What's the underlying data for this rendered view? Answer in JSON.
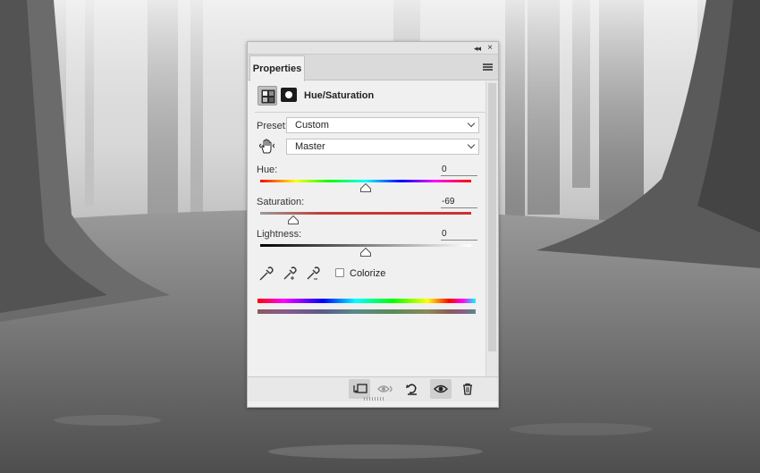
{
  "panel": {
    "tab_label": "Properties",
    "adjustment_title": "Hue/Saturation",
    "preset_label": "Preset:",
    "preset_value": "Custom",
    "channel_value": "Master",
    "hue": {
      "label": "Hue:",
      "value": "0",
      "fraction": 0.5
    },
    "saturation": {
      "label": "Saturation:",
      "value": "-69",
      "fraction": 0.155
    },
    "lightness": {
      "label": "Lightness:",
      "value": "0",
      "fraction": 0.5
    },
    "colorize_label": "Colorize",
    "colorize_checked": false
  },
  "icons": {
    "collapse": "double-chevron-left-icon",
    "close": "close-icon",
    "menu": "panel-menu-icon",
    "adjustment": "hue-saturation-icon",
    "mask": "layer-mask-icon",
    "targeted_adjustment": "hand-icon",
    "eyedroppers": [
      "eyedropper-icon",
      "eyedropper-add-icon",
      "eyedropper-subtract-icon"
    ],
    "bottom": [
      "clip-to-layer-icon",
      "view-previous-state-icon",
      "reset-icon",
      "toggle-visibility-icon",
      "trash-icon"
    ]
  },
  "colors": {
    "panel_bg": "#f0f0f0",
    "tab_bar": "#dadada",
    "saturation_track": "#c33a3a"
  }
}
